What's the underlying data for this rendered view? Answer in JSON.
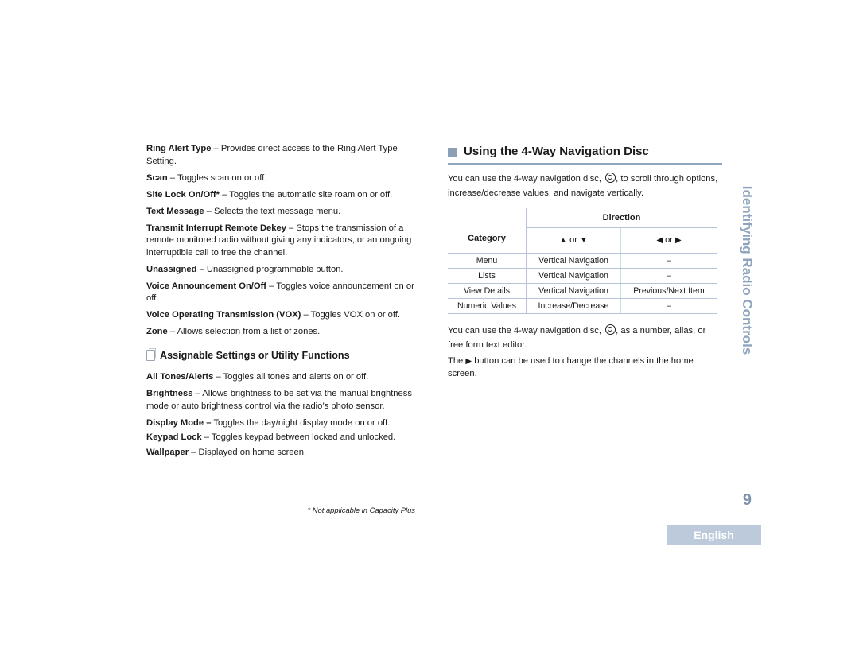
{
  "left_column": {
    "items_a": [
      {
        "term": "Ring Alert Type",
        "sep": " – ",
        "desc": "Provides direct access to the Ring Alert Type Setting."
      },
      {
        "term": "Scan",
        "sep": " – ",
        "desc": "Toggles scan on or off."
      },
      {
        "term": "Site Lock On/Off*",
        "sep": " – ",
        "desc": "Toggles the automatic site roam on or off."
      },
      {
        "term": "Text Message",
        "sep": " – ",
        "desc": "Selects the text message menu."
      },
      {
        "term": "Transmit Interrupt Remote Dekey",
        "sep": " – ",
        "desc": "Stops the transmission of a remote monitored radio without giving any indicators, or an ongoing interruptible call to free the channel."
      },
      {
        "term": "Unassigned –",
        "sep": " ",
        "desc": "Unassigned programmable button."
      },
      {
        "term": "Voice Announcement On/Off",
        "sep": " – ",
        "desc": "Toggles voice announcement on or off."
      },
      {
        "term": "Voice Operating Transmission (VOX)",
        "sep": " – ",
        "desc": "Toggles VOX on or off."
      },
      {
        "term": "Zone",
        "sep": " – ",
        "desc": "Allows selection from a list of zones."
      }
    ],
    "subheading": "Assignable Settings or Utility Functions",
    "items_b": [
      {
        "term": "All Tones/Alerts",
        "sep": " – ",
        "desc": "Toggles all tones and alerts on or off."
      },
      {
        "term": "Brightness",
        "sep": " – ",
        "desc": "Allows brightness to be set via the manual brightness mode or auto brightness control via the radio’s photo sensor."
      },
      {
        "term": "Display Mode –",
        "sep": " ",
        "desc": "Toggles the day/night display mode on or off."
      },
      {
        "term": "Keypad Lock",
        "sep": " – ",
        "desc": "Toggles keypad between locked and unlocked."
      },
      {
        "term": "Wallpaper",
        "sep": " – ",
        "desc": "Displayed on home screen."
      }
    ],
    "footnote": "* Not applicable in Capacity Plus"
  },
  "right_column": {
    "title": "Using the 4-Way Navigation Disc",
    "intro_before": "You can use the 4-way navigation disc, ",
    "intro_after": ", to scroll through options, increase/decrease values, and navigate vertically.",
    "table": {
      "category_header": "Category",
      "direction_header": "Direction",
      "sub_headers": [
        {
          "a": "▲",
          "or": " or ",
          "b": "▼"
        },
        {
          "a": "◀",
          "or": " or ",
          "b": "▶"
        }
      ],
      "rows": [
        [
          "Menu",
          "Vertical Navigation",
          "–"
        ],
        [
          "Lists",
          "Vertical Navigation",
          "–"
        ],
        [
          "View Details",
          "Vertical Navigation",
          "Previous/Next Item"
        ],
        [
          "Numeric Values",
          "Increase/Decrease",
          "–"
        ]
      ]
    },
    "para2_before": "You can use the 4-way navigation disc, ",
    "para2_after": ", as a number, alias, or free form text editor.",
    "para3_before": "The ",
    "para3_icon": "▶",
    "para3_after": " button can be used to change the channels in the home screen."
  },
  "side_tab": "Identifying Radio Controls",
  "page_number": "9",
  "language_tab": "English",
  "colors": {
    "accent": "#8fa4bd",
    "language_tab_bg": "#bccadb",
    "page_number": "#8094ad"
  }
}
